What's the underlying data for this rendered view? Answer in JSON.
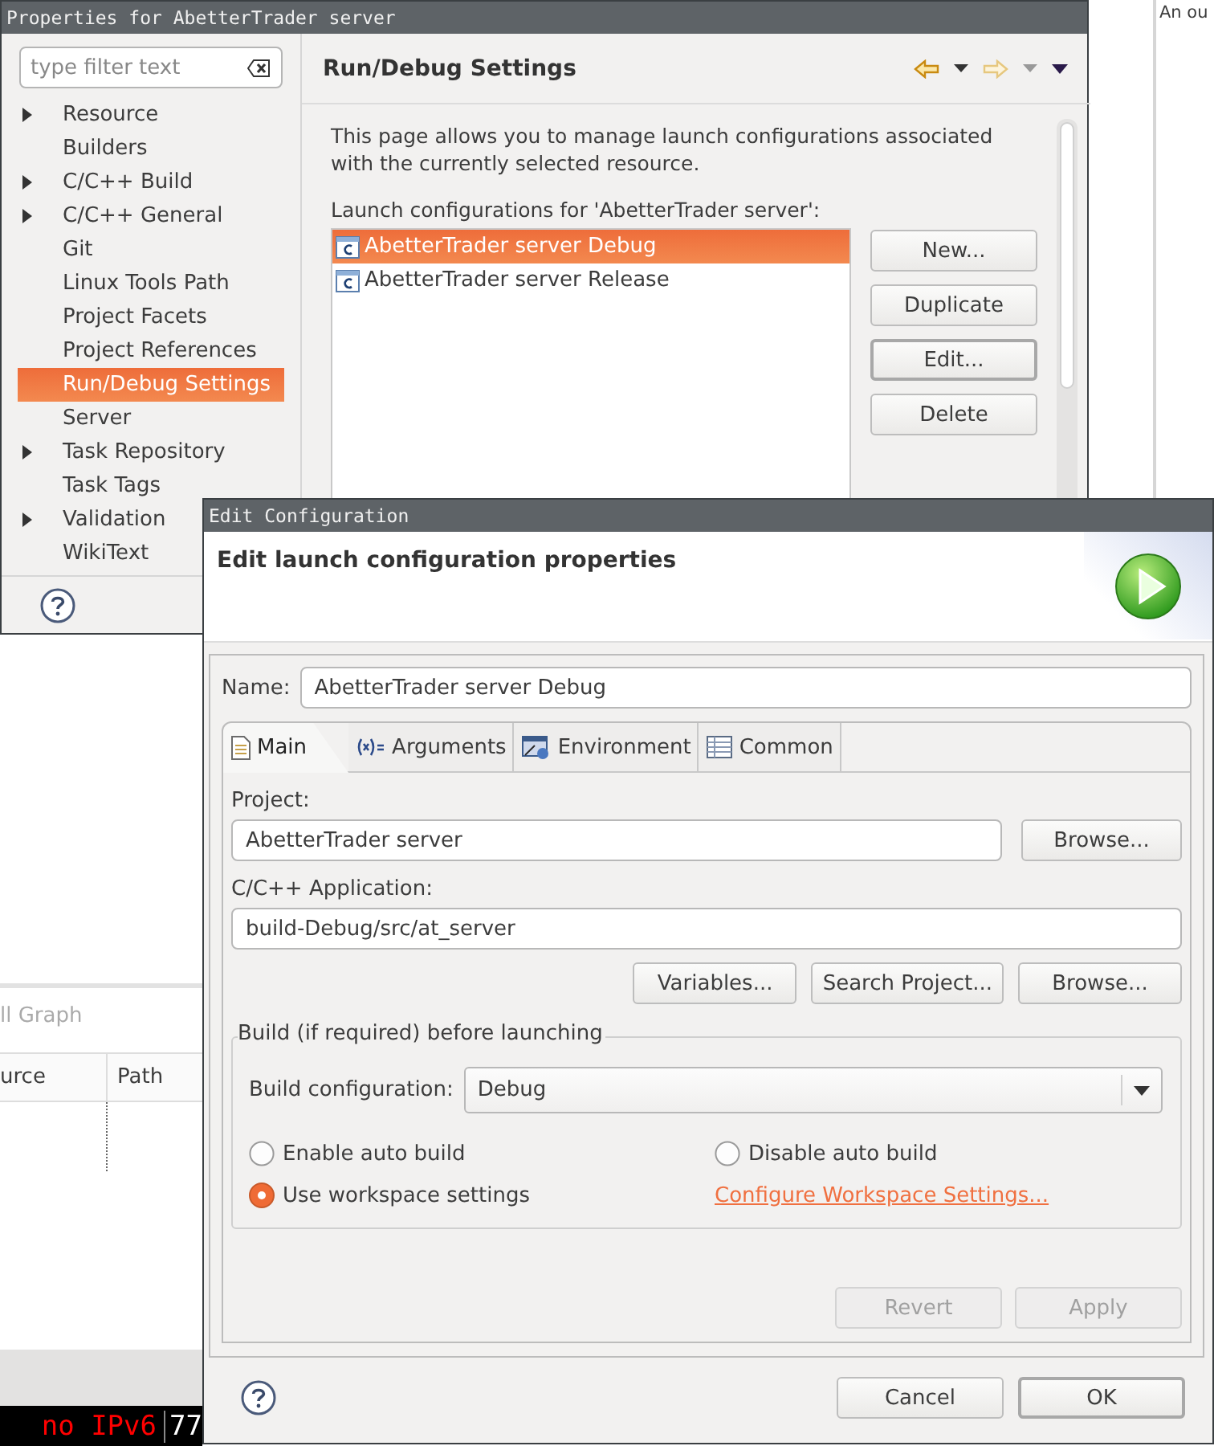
{
  "background": {
    "right_pane_text": "An ou",
    "bottom_panel": {
      "tab": "ll Graph",
      "columns": [
        "urce",
        "Path"
      ]
    },
    "terminal": {
      "status": "no IPv6",
      "number": "77"
    }
  },
  "properties_window": {
    "title": "Properties for AbetterTrader server",
    "filter": {
      "placeholder": "type filter text"
    },
    "tree": [
      {
        "label": "Resource",
        "expandable": true,
        "selected": false
      },
      {
        "label": "Builders",
        "expandable": false,
        "selected": false
      },
      {
        "label": "C/C++ Build",
        "expandable": true,
        "selected": false
      },
      {
        "label": "C/C++ General",
        "expandable": true,
        "selected": false
      },
      {
        "label": "Git",
        "expandable": false,
        "selected": false
      },
      {
        "label": "Linux Tools Path",
        "expandable": false,
        "selected": false
      },
      {
        "label": "Project Facets",
        "expandable": false,
        "selected": false
      },
      {
        "label": "Project References",
        "expandable": false,
        "selected": false
      },
      {
        "label": "Run/Debug Settings",
        "expandable": false,
        "selected": true
      },
      {
        "label": "Server",
        "expandable": false,
        "selected": false
      },
      {
        "label": "Task Repository",
        "expandable": true,
        "selected": false
      },
      {
        "label": "Task Tags",
        "expandable": false,
        "selected": false
      },
      {
        "label": "Validation",
        "expandable": true,
        "selected": false
      },
      {
        "label": "WikiText",
        "expandable": false,
        "selected": false
      }
    ],
    "page": {
      "title": "Run/Debug Settings",
      "description": "This page allows you to manage launch configurations associated with the currently selected resource.",
      "list_label": "Launch configurations for 'AbetterTrader server':",
      "configurations": [
        {
          "name": "AbetterTrader server Debug",
          "selected": true
        },
        {
          "name": "AbetterTrader server Release",
          "selected": false
        }
      ],
      "buttons": [
        {
          "label": "New...",
          "focused": false
        },
        {
          "label": "Duplicate",
          "focused": false
        },
        {
          "label": "Edit...",
          "focused": true
        },
        {
          "label": "Delete",
          "focused": false
        }
      ]
    }
  },
  "edit_dialog": {
    "title": "Edit Configuration",
    "heading": "Edit launch configuration properties",
    "name_label": "Name:",
    "name_value": "AbetterTrader server Debug",
    "tabs": [
      {
        "label": "Main",
        "kind": "document",
        "selected": true
      },
      {
        "label": "Arguments",
        "kind": "variables",
        "selected": false
      },
      {
        "label": "Environment",
        "kind": "environment",
        "selected": false
      },
      {
        "label": "Common",
        "kind": "table",
        "selected": false
      }
    ],
    "project_label": "Project:",
    "project_value": "AbetterTrader server",
    "project_browse": "Browse...",
    "app_label": "C/C++ Application:",
    "app_value": "build-Debug/src/at_server",
    "app_buttons": [
      "Variables...",
      "Search Project...",
      "Browse..."
    ],
    "build_group": {
      "title": "Build (if required) before launching",
      "config_label": "Build configuration:",
      "config_value": "Debug",
      "options": [
        {
          "label": "Enable auto build",
          "selected": false
        },
        {
          "label": "Disable auto build",
          "selected": false
        },
        {
          "label": "Use workspace settings",
          "selected": true
        }
      ],
      "link": "Configure Workspace Settings..."
    },
    "revert": {
      "label": "Revert",
      "disabled": true
    },
    "apply": {
      "label": "Apply",
      "disabled": true
    },
    "cancel": "Cancel",
    "ok": "OK"
  }
}
